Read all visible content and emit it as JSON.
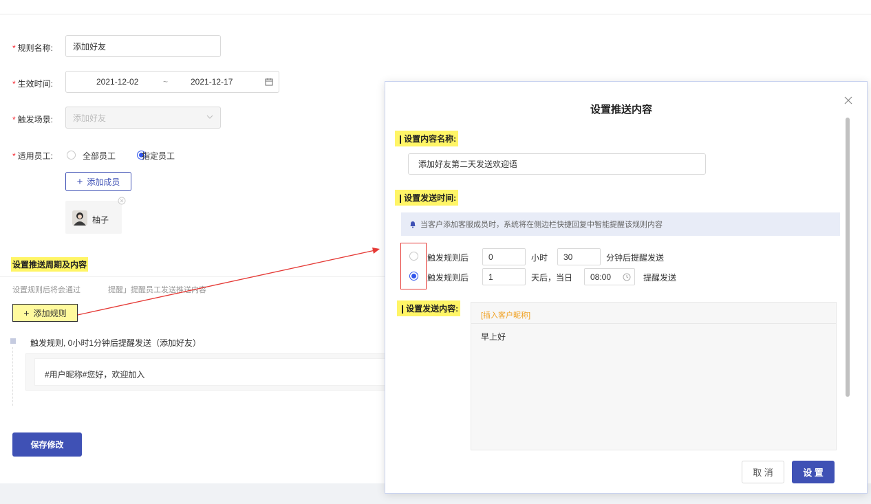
{
  "form": {
    "rule_name_label": "规则名称:",
    "rule_name_value": "添加好友",
    "effective_time_label": "生效时间:",
    "date_start": "2021-12-02",
    "date_sep": "~",
    "date_end": "2021-12-17",
    "trigger_label": "触发场景:",
    "trigger_value": "添加好友",
    "staff_label": "适用员工:",
    "staff_all": "全部员工",
    "staff_specified": "指定员工",
    "add_member": "添加成员",
    "member_name": "柚子"
  },
  "push_section": {
    "title": "设置推送周期及内容",
    "desc_prefix": "设置规则后将会通过",
    "desc_suffix": "提醒」提醒员工发送推送内容",
    "add_rule": "添加规则",
    "rule_item": "触发规则, 0小时1分钟后提醒发送（添加好友）",
    "rule_content": "#用户昵称#您好，欢迎加入"
  },
  "save_button": "保存修改",
  "modal": {
    "title": "设置推送内容",
    "name_section": "设置内容名称:",
    "name_value": "添加好友第二天发送欢迎语",
    "time_section": "设置发送时间:",
    "info": "当客户添加客服成员时，系统将在侧边栏快捷回复中智能提醒该规则内容",
    "opt1_prefix": "触发规则后",
    "opt1_hours": "0",
    "opt1_hours_unit": "小时",
    "opt1_minutes": "30",
    "opt1_suffix": "分钟后提醒发送",
    "opt2_prefix": "触发规则后",
    "opt2_days": "1",
    "opt2_days_unit": "天后，当日",
    "opt2_time": "08:00",
    "opt2_suffix": "提醒发送",
    "content_section": "设置发送内容:",
    "insert_nickname": "[插入客户昵称]",
    "content_text": "早上好",
    "cancel": "取 消",
    "confirm": "设 置"
  },
  "colors": {
    "primary": "#3f51b5",
    "highlight": "#fff566",
    "required": "#f5222d",
    "annotation": "#e53935"
  }
}
